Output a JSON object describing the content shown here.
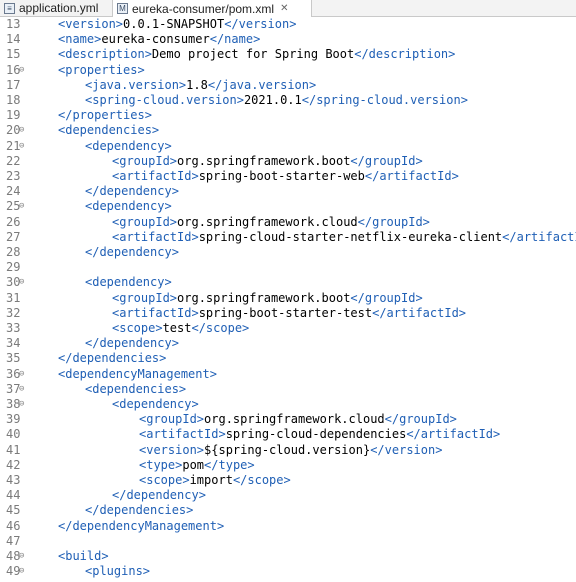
{
  "tabs": [
    {
      "label": "application.yml",
      "icon": "yaml-file-icon"
    },
    {
      "label": "eureka-consumer/pom.xml",
      "icon": "maven-pom-icon",
      "close": "✕"
    }
  ],
  "lines": [
    {
      "n": "13",
      "fold": false,
      "indent": 0,
      "open": "<version>",
      "text": "0.0.1-SNAPSHOT",
      "close": "</version>"
    },
    {
      "n": "14",
      "fold": false,
      "indent": 0,
      "open": "<name>",
      "text": "eureka-consumer",
      "close": "</name>"
    },
    {
      "n": "15",
      "fold": false,
      "indent": 0,
      "open": "<description>",
      "text": "Demo project for Spring Boot",
      "close": "</description>"
    },
    {
      "n": "16",
      "fold": true,
      "indent": 0,
      "open": "<properties>",
      "text": "",
      "close": ""
    },
    {
      "n": "17",
      "fold": false,
      "indent": 1,
      "open": "<java.version>",
      "text": "1.8",
      "close": "</java.version>"
    },
    {
      "n": "18",
      "fold": false,
      "indent": 1,
      "open": "<spring-cloud.version>",
      "text": "2021.0.1",
      "close": "</spring-cloud.version>"
    },
    {
      "n": "19",
      "fold": false,
      "indent": 0,
      "open": "</properties>",
      "text": "",
      "close": ""
    },
    {
      "n": "20",
      "fold": true,
      "indent": 0,
      "open": "<dependencies>",
      "text": "",
      "close": ""
    },
    {
      "n": "21",
      "fold": true,
      "indent": 1,
      "open": "<dependency>",
      "text": "",
      "close": ""
    },
    {
      "n": "22",
      "fold": false,
      "indent": 2,
      "open": "<groupId>",
      "text": "org.springframework.boot",
      "close": "</groupId>"
    },
    {
      "n": "23",
      "fold": false,
      "indent": 2,
      "open": "<artifactId>",
      "text": "spring-boot-starter-web",
      "close": "</artifactId>"
    },
    {
      "n": "24",
      "fold": false,
      "indent": 1,
      "open": "</dependency>",
      "text": "",
      "close": ""
    },
    {
      "n": "25",
      "fold": true,
      "indent": 1,
      "open": "<dependency>",
      "text": "",
      "close": ""
    },
    {
      "n": "26",
      "fold": false,
      "indent": 2,
      "open": "<groupId>",
      "text": "org.springframework.cloud",
      "close": "</groupId>"
    },
    {
      "n": "27",
      "fold": false,
      "indent": 2,
      "open": "<artifactId>",
      "text": "spring-cloud-starter-netflix-eureka-client",
      "close": "</artifactId>"
    },
    {
      "n": "28",
      "fold": false,
      "indent": 1,
      "open": "</dependency>",
      "text": "",
      "close": ""
    },
    {
      "n": "29",
      "fold": false,
      "indent": 0,
      "open": "",
      "text": "",
      "close": ""
    },
    {
      "n": "30",
      "fold": true,
      "indent": 1,
      "open": "<dependency>",
      "text": "",
      "close": ""
    },
    {
      "n": "31",
      "fold": false,
      "indent": 2,
      "open": "<groupId>",
      "text": "org.springframework.boot",
      "close": "</groupId>"
    },
    {
      "n": "32",
      "fold": false,
      "indent": 2,
      "open": "<artifactId>",
      "text": "spring-boot-starter-test",
      "close": "</artifactId>"
    },
    {
      "n": "33",
      "fold": false,
      "indent": 2,
      "open": "<scope>",
      "text": "test",
      "close": "</scope>"
    },
    {
      "n": "34",
      "fold": false,
      "indent": 1,
      "open": "</dependency>",
      "text": "",
      "close": ""
    },
    {
      "n": "35",
      "fold": false,
      "indent": 0,
      "open": "</dependencies>",
      "text": "",
      "close": ""
    },
    {
      "n": "36",
      "fold": true,
      "indent": 0,
      "open": "<dependencyManagement>",
      "text": "",
      "close": ""
    },
    {
      "n": "37",
      "fold": true,
      "indent": 1,
      "open": "<dependencies>",
      "text": "",
      "close": ""
    },
    {
      "n": "38",
      "fold": true,
      "indent": 2,
      "open": "<dependency>",
      "text": "",
      "close": ""
    },
    {
      "n": "39",
      "fold": false,
      "indent": 3,
      "open": "<groupId>",
      "text": "org.springframework.cloud",
      "close": "</groupId>"
    },
    {
      "n": "40",
      "fold": false,
      "indent": 3,
      "open": "<artifactId>",
      "text": "spring-cloud-dependencies",
      "close": "</artifactId>"
    },
    {
      "n": "41",
      "fold": false,
      "indent": 3,
      "open": "<version>",
      "text": "${spring-cloud.version}",
      "close": "</version>"
    },
    {
      "n": "42",
      "fold": false,
      "indent": 3,
      "open": "<type>",
      "text": "pom",
      "close": "</type>"
    },
    {
      "n": "43",
      "fold": false,
      "indent": 3,
      "open": "<scope>",
      "text": "import",
      "close": "</scope>"
    },
    {
      "n": "44",
      "fold": false,
      "indent": 2,
      "open": "</dependency>",
      "text": "",
      "close": ""
    },
    {
      "n": "45",
      "fold": false,
      "indent": 1,
      "open": "</dependencies>",
      "text": "",
      "close": ""
    },
    {
      "n": "46",
      "fold": false,
      "indent": 0,
      "open": "</dependencyManagement>",
      "text": "",
      "close": ""
    },
    {
      "n": "47",
      "fold": false,
      "indent": 0,
      "open": "",
      "text": "",
      "close": ""
    },
    {
      "n": "48",
      "fold": true,
      "indent": 0,
      "open": "<build>",
      "text": "",
      "close": ""
    },
    {
      "n": "49",
      "fold": true,
      "indent": 1,
      "open": "<plugins>",
      "text": "",
      "close": ""
    }
  ],
  "colors": {
    "tag": "#1f5fb5",
    "text": "#000000",
    "line_number": "#7b7b7b"
  }
}
